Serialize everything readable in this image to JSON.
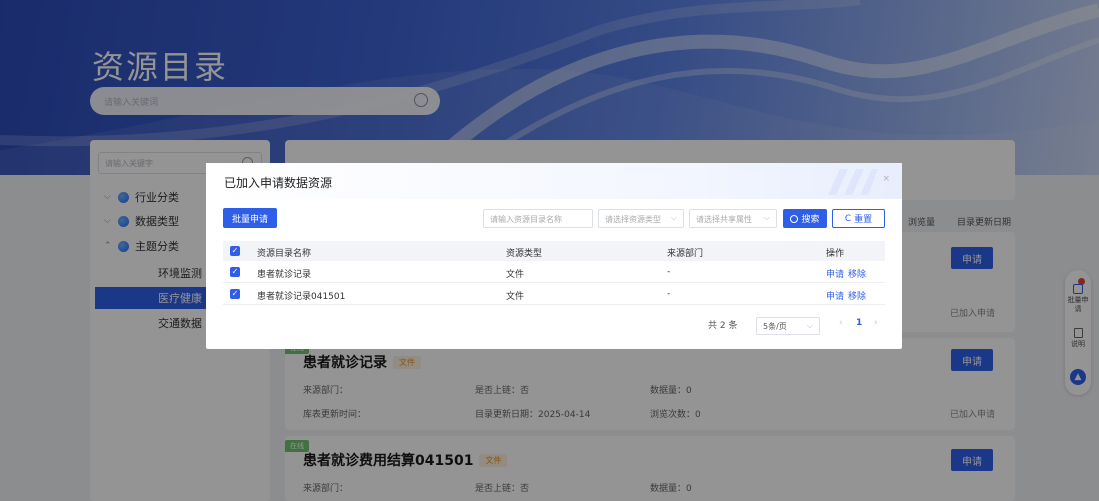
{
  "hero": {
    "title": "资源目录",
    "search_placeholder": "请输入关键词"
  },
  "sidebar": {
    "search_placeholder": "请输入关键字",
    "groups": [
      {
        "label": "行业分类",
        "expanded": false
      },
      {
        "label": "数据类型",
        "expanded": false
      },
      {
        "label": "主题分类",
        "expanded": true
      }
    ],
    "subitems": [
      "环境监测",
      "医疗健康",
      "交通数据"
    ],
    "active_subitem": "医疗健康"
  },
  "list": {
    "col_headers": [
      "浏览量",
      "目录更新日期"
    ],
    "apply_label": "申请",
    "added_label": "已加入申请",
    "file_tag": "文件",
    "new_tag": "在线",
    "cards": [
      {
        "title": "患者就诊记录",
        "source_dept_label": "来源部门：",
        "listed_label": "是否上链：否",
        "count_label": "数据量：0",
        "table_update_label": "库表更新时间：",
        "dir_update_label": "目录更新日期：2025-04-14",
        "views_label": "浏览次数：0"
      },
      {
        "title": "患者就诊费用结算041501",
        "source_dept_label": "来源部门：",
        "listed_label": "是否上链：否",
        "count_label": "数据量：0"
      }
    ]
  },
  "modal": {
    "title": "已加入申请数据资源",
    "close": "×",
    "batch_button": "批量申请",
    "filter_name_placeholder": "请输入资源目录名称",
    "filter_type_placeholder": "请选择资源类型",
    "filter_share_placeholder": "请选择共享属性",
    "search_button": "搜索",
    "reset_button": "重置",
    "columns": [
      "资源目录名称",
      "资源类型",
      "来源部门",
      "操作"
    ],
    "rows": [
      {
        "name": "患者就诊记录",
        "type": "文件",
        "dept": "-",
        "op_apply": "申请",
        "op_remove": "移除"
      },
      {
        "name": "患者就诊记录041501",
        "type": "文件",
        "dept": "-",
        "op_apply": "申请",
        "op_remove": "移除"
      }
    ],
    "pagination": {
      "total": "共 2 条",
      "page_size": "5条/页",
      "prev": "‹",
      "current_page": "1",
      "next": "›"
    }
  },
  "float_bar": {
    "apply_label": "批量申请",
    "help_label": "说明"
  },
  "colors": {
    "primary": "#2f5fe8",
    "tag_orange": "#e8902d",
    "ribbon_green": "#6fc36b"
  }
}
